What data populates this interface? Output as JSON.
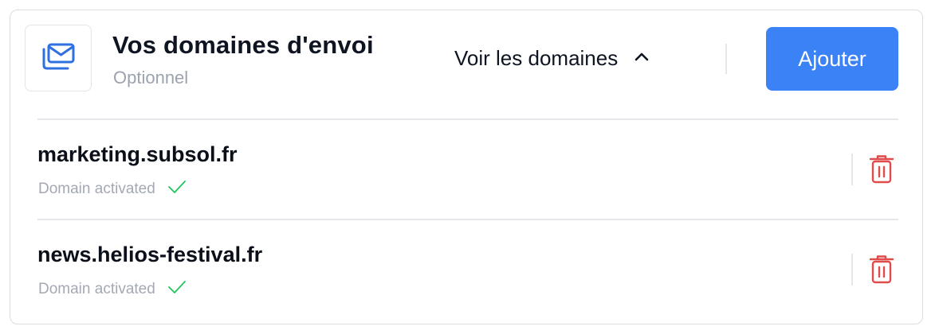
{
  "card": {
    "title": "Vos domaines d'envoi",
    "subtitle": "Optionnel",
    "icon": "mail-stack-icon",
    "toggle_label": "Voir les domaines",
    "toggle_icon": "chevron-up-icon",
    "add_label": "Ajouter"
  },
  "domains": [
    {
      "name": "marketing.subsol.fr",
      "status": "Domain activated",
      "status_icon": "check-icon",
      "action_icon": "trash-icon"
    },
    {
      "name": "news.helios-festival.fr",
      "status": "Domain activated",
      "status_icon": "check-icon",
      "action_icon": "trash-icon"
    }
  ],
  "colors": {
    "accent": "#3b82f6",
    "icon_blue": "#2f6fe0",
    "success": "#22c55e",
    "danger": "#e04b4b",
    "text_dark": "#0e1422",
    "text_muted": "#9ca3af"
  }
}
